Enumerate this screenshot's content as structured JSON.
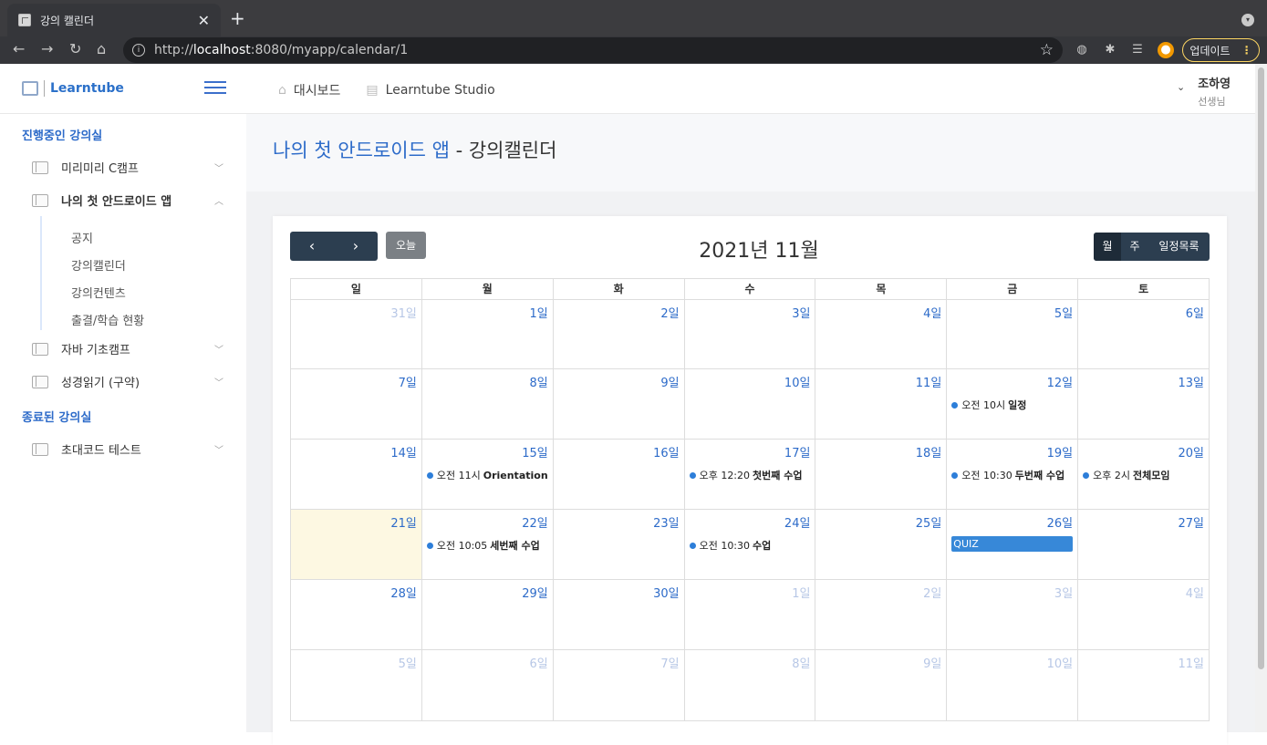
{
  "browser": {
    "tab_title": "강의 캘린더",
    "tab_close": "✕",
    "new_tab": "+",
    "url_host": "localhost",
    "url_prefix": "http://",
    "url_rest": ":8080/myapp/calendar/1",
    "update_label": "업데이트"
  },
  "header": {
    "logo_text": "Learntube",
    "nav": [
      {
        "label": "대시보드",
        "icon": "home-icon"
      },
      {
        "label": "Learntube Studio",
        "icon": "film-icon"
      }
    ],
    "user_name": "조하영",
    "user_role": "선생님"
  },
  "sidebar": {
    "active_title": "진행중인 강의실",
    "courses": [
      "미리미리 C캠프",
      "나의 첫 안드로이드 앱",
      "자바 기초캠프",
      "성경읽기 (구약)"
    ],
    "submenu": [
      "공지",
      "강의캘린더",
      "강의컨텐츠",
      "출결/학습 현황"
    ],
    "ended_title": "종료된 강의실",
    "ended_courses": [
      "초대코드 테스트"
    ]
  },
  "page": {
    "course_name": "나의 첫 안드로이드 앱",
    "separator": " - ",
    "page_name": "강의캘린더"
  },
  "calendar": {
    "title": "2021년 11월",
    "today_label": "오늘",
    "views": [
      "월",
      "주",
      "일정목록"
    ],
    "active_view": "월",
    "weekdays": [
      "일",
      "월",
      "화",
      "수",
      "목",
      "금",
      "토"
    ],
    "weeks": [
      [
        {
          "d": "31일",
          "other": true
        },
        {
          "d": "1일"
        },
        {
          "d": "2일"
        },
        {
          "d": "3일"
        },
        {
          "d": "4일"
        },
        {
          "d": "5일"
        },
        {
          "d": "6일"
        }
      ],
      [
        {
          "d": "7일"
        },
        {
          "d": "8일"
        },
        {
          "d": "9일"
        },
        {
          "d": "10일"
        },
        {
          "d": "11일"
        },
        {
          "d": "12일",
          "ev": {
            "time": "오전 10시",
            "title": "일정"
          }
        },
        {
          "d": "13일"
        }
      ],
      [
        {
          "d": "14일"
        },
        {
          "d": "15일",
          "ev": {
            "time": "오전 11시",
            "title": "Orientation"
          }
        },
        {
          "d": "16일"
        },
        {
          "d": "17일",
          "ev": {
            "time": "오후 12:20",
            "title": "첫번째 수업"
          }
        },
        {
          "d": "18일"
        },
        {
          "d": "19일",
          "ev": {
            "time": "오전 10:30",
            "title": "두번째 수업"
          }
        },
        {
          "d": "20일",
          "ev": {
            "time": "오후 2시",
            "title": "전체모임"
          }
        }
      ],
      [
        {
          "d": "21일",
          "today": true
        },
        {
          "d": "22일",
          "ev": {
            "time": "오전 10:05",
            "title": "세번째 수업"
          }
        },
        {
          "d": "23일"
        },
        {
          "d": "24일",
          "ev": {
            "time": "오전 10:30",
            "title": "수업"
          }
        },
        {
          "d": "25일"
        },
        {
          "d": "26일",
          "block": "QUIZ"
        },
        {
          "d": "27일"
        }
      ],
      [
        {
          "d": "28일"
        },
        {
          "d": "29일"
        },
        {
          "d": "30일"
        },
        {
          "d": "1일",
          "other": true
        },
        {
          "d": "2일",
          "other": true
        },
        {
          "d": "3일",
          "other": true
        },
        {
          "d": "4일",
          "other": true
        }
      ],
      [
        {
          "d": "5일",
          "other": true
        },
        {
          "d": "6일",
          "other": true
        },
        {
          "d": "7일",
          "other": true
        },
        {
          "d": "8일",
          "other": true
        },
        {
          "d": "9일",
          "other": true
        },
        {
          "d": "10일",
          "other": true
        },
        {
          "d": "11일",
          "other": true
        }
      ]
    ]
  }
}
